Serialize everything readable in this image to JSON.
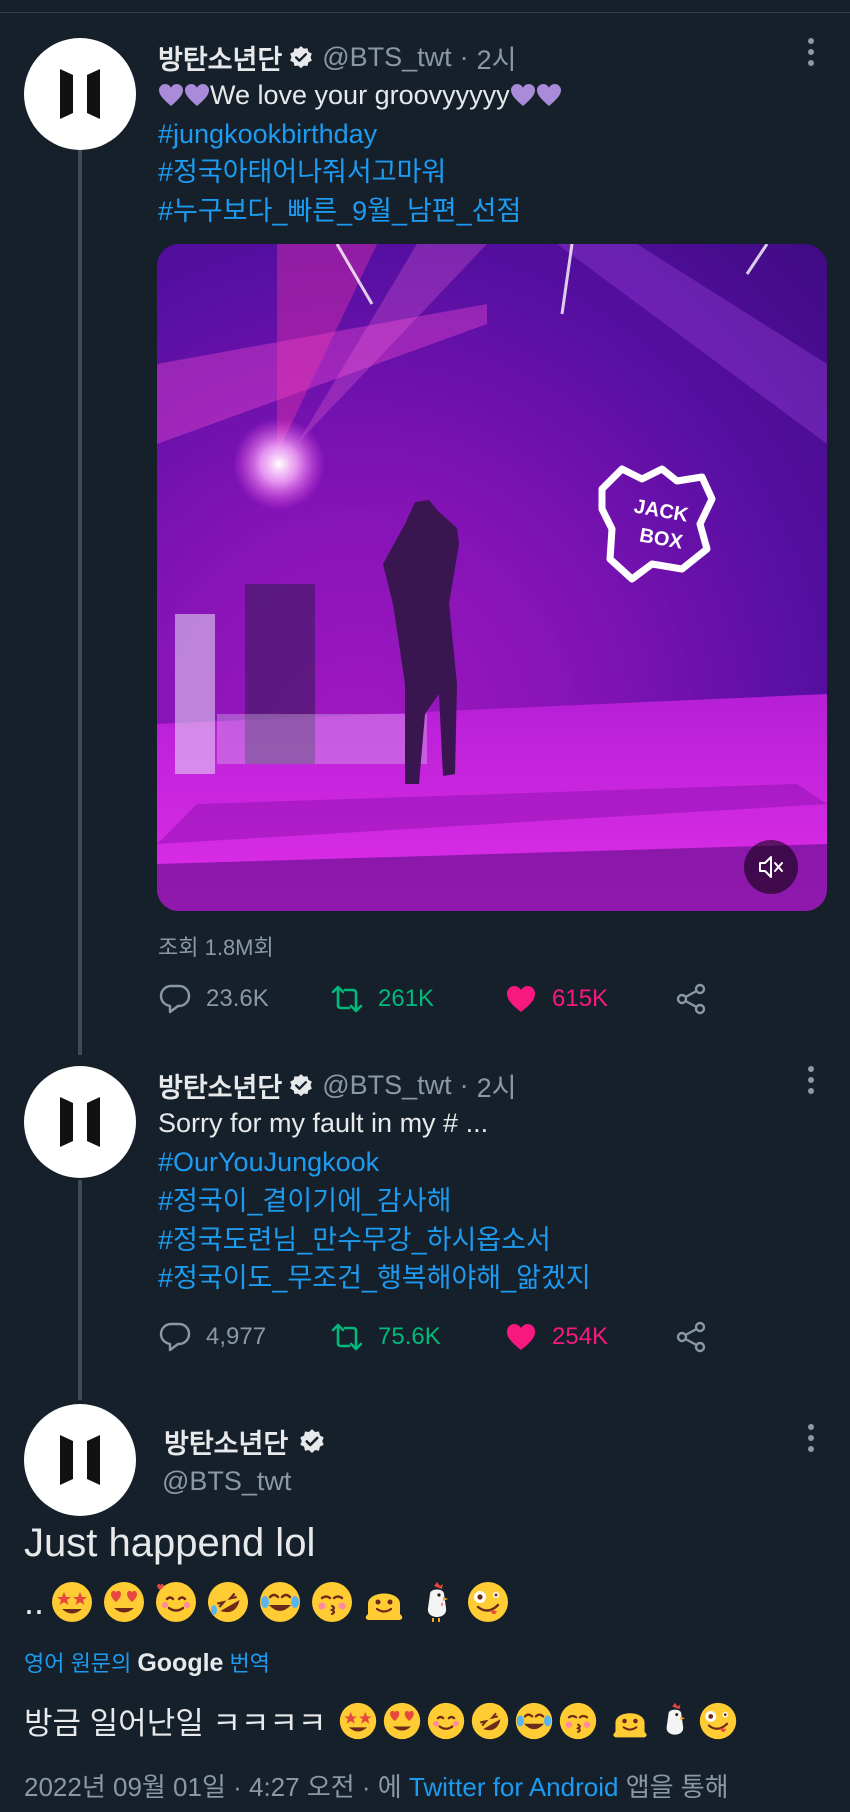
{
  "tweets": [
    {
      "name": "방탄소년단",
      "handle": "@BTS_twt",
      "dot": "·",
      "time": "2시",
      "text_main": "We love your groovyyyyy",
      "hashtags": [
        "#jungkookbirthday",
        "#정국아태어나줘서고마워",
        "#누구보다_빠른_9월_남편_선점"
      ],
      "views": "조회 1.8M회",
      "stats": {
        "replies": "23.6K",
        "retweets": "261K",
        "likes": "615K"
      },
      "media": {
        "sign_line1": "JACK",
        "sign_line2": "BOX"
      }
    },
    {
      "name": "방탄소년단",
      "handle": "@BTS_twt",
      "dot": "·",
      "time": "2시",
      "text_main": "Sorry for my fault in my # ...",
      "hashtags": [
        "#OurYouJungkook",
        "#정국이_곁이기에_감사해",
        "#정국도련님_만수무강_하시옵소서",
        "#정국이도_무조건_행복해야해_앎겠지"
      ],
      "stats": {
        "replies": "4,977",
        "retweets": "75.6K",
        "likes": "254K"
      }
    }
  ],
  "main_tweet": {
    "name": "방탄소년단",
    "handle": "@BTS_twt",
    "text": "Just happend lol",
    "emoji_lead": "..",
    "translate_prefix": "영어 원문의",
    "translate_brand": "Google",
    "translate_suffix": "번역",
    "translated": "방금 일어난일 ㅋㅋㅋㅋ",
    "footer_date": "2022년 09월 01일 · 4:27 오전 · 에 ",
    "footer_app": "Twitter for Android",
    "footer_suffix": " 앱을 통해"
  },
  "icons": [
    "bts-logo-icon",
    "verified-badge-icon",
    "more-icon",
    "reply-icon",
    "retweet-icon",
    "heart-icon",
    "share-icon",
    "mute-icon"
  ],
  "colors": {
    "background": "#15202b",
    "link": "#1d9bf0",
    "retweet": "#00ba7c",
    "like": "#f91880",
    "muted": "#8b98a5"
  }
}
